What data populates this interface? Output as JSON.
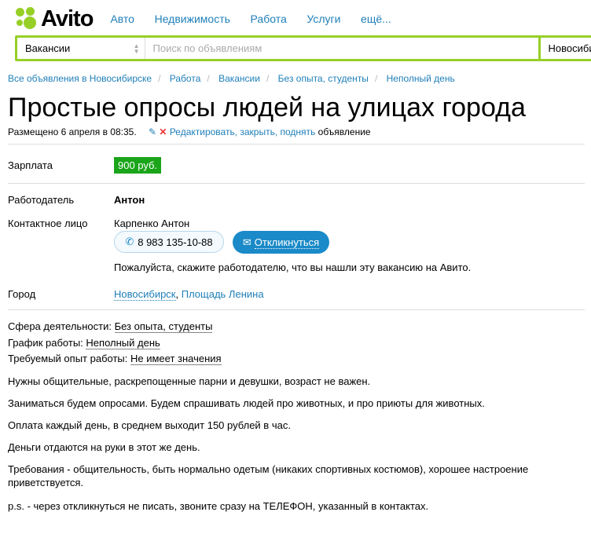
{
  "header": {
    "logo": "Avito",
    "nav": [
      "Авто",
      "Недвижимость",
      "Работа",
      "Услуги",
      "ещё..."
    ]
  },
  "search": {
    "category": "Вакансии",
    "placeholder": "Поиск по объявлениям",
    "city": "Новосибирск"
  },
  "breadcrumbs": [
    "Все объявления в Новосибирске",
    "Работа",
    "Вакансии",
    "Без опыта, студенты",
    "Неполный день"
  ],
  "title": "Простые опросы людей на улицах города",
  "meta": {
    "posted": "Размещено 6 апреля в 08:35.",
    "actions": "Редактировать, закрыть, поднять",
    "suffix": "объявление"
  },
  "salary": {
    "label": "Зарплата",
    "value": "900 руб."
  },
  "employer": {
    "label": "Работодатель",
    "value": "Антон"
  },
  "contact": {
    "label": "Контактное лицо",
    "value": "Карпенко Антон",
    "phone": "8 983 135-10-88",
    "reply": "Откликнуться",
    "note": "Пожалуйста, скажите работодателю, что вы нашли эту вакансию на Авито."
  },
  "city": {
    "label": "Город",
    "city": "Новосибирск",
    "place": "Площадь Ленина"
  },
  "params": [
    {
      "label": "Сфера деятельности:",
      "value": "Без опыта, студенты"
    },
    {
      "label": "График работы:",
      "value": "Неполный день"
    },
    {
      "label": "Требуемый опыт работы:",
      "value": "Не имеет значения"
    }
  ],
  "description": [
    "Нужны общительные, раскрепощенные парни и девушки, возраст не важен.",
    "Заниматься будем опросами. Будем спрашивать людей про животных, и про приюты для животных.",
    "Оплата каждый день, в среднем выходит 150 рублей в час.",
    "Деньги отдаются на руки в этот же день.",
    "Требования - общительность, быть нормально одетым (никаких спортивных костюмов), хорошее настроение приветствуется.",
    "p.s. - через откликнуться не писать, звоните сразу на ТЕЛЕФОН, указанный в контактах."
  ]
}
